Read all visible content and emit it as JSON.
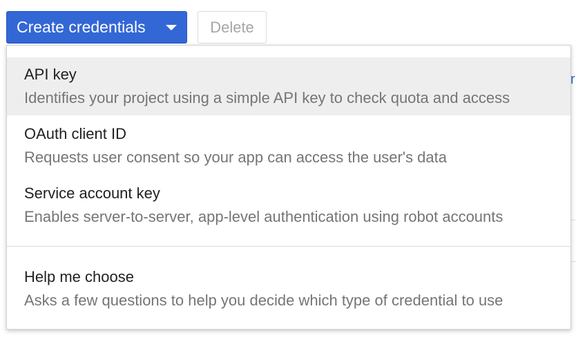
{
  "toolbar": {
    "create_label": "Create credentials",
    "delete_label": "Delete"
  },
  "menu": {
    "items": [
      {
        "title": "API key",
        "description": "Identifies your project using a simple API key to check quota and access"
      },
      {
        "title": "OAuth client ID",
        "description": "Requests user consent so your app can access the user's data"
      },
      {
        "title": "Service account key",
        "description": "Enables server-to-server, app-level authentication using robot accounts"
      },
      {
        "title": "Help me choose",
        "description": "Asks a few questions to help you decide which type of credential to use"
      }
    ]
  },
  "colors": {
    "primary_button": "#3367d6",
    "hover_row": "#eeeeee",
    "disabled_text": "#a6a6a6"
  },
  "icons": {
    "dropdown": "caret-down-icon"
  }
}
